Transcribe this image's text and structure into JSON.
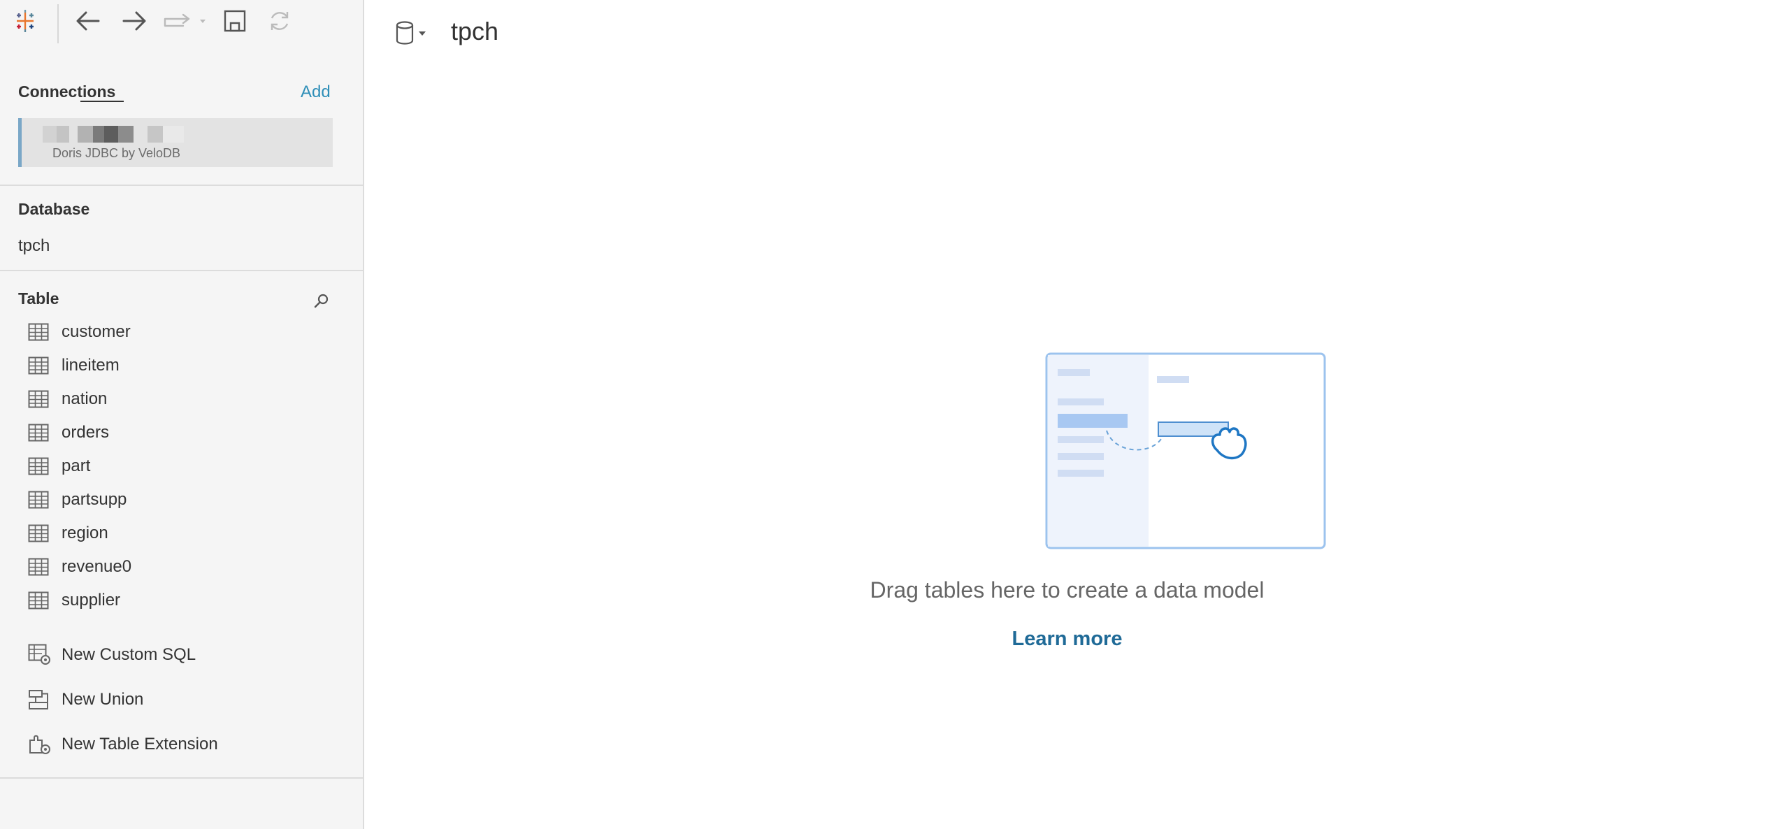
{
  "sidebar": {
    "connections_title": "Connections",
    "add_label": "Add",
    "connection": {
      "name": "Doris JDBC by VeloDB"
    },
    "database_title": "Database",
    "database_name": "tpch",
    "table_title": "Table",
    "tables": [
      {
        "label": "customer"
      },
      {
        "label": "lineitem"
      },
      {
        "label": "nation"
      },
      {
        "label": "orders"
      },
      {
        "label": "part"
      },
      {
        "label": "partsupp"
      },
      {
        "label": "region"
      },
      {
        "label": "revenue0"
      },
      {
        "label": "supplier"
      }
    ],
    "actions": [
      {
        "label": "New Custom SQL",
        "icon": "custom-sql-icon"
      },
      {
        "label": "New Union",
        "icon": "union-icon"
      },
      {
        "label": "New Table Extension",
        "icon": "table-extension-icon"
      }
    ]
  },
  "toolbar": {
    "icons": [
      "tableau-logo-icon",
      "back-arrow-icon",
      "forward-arrow-icon",
      "redo-dropdown-icon",
      "save-icon",
      "refresh-icon"
    ]
  },
  "main": {
    "datasource_title": "tpch",
    "empty_message": "Drag tables here to create a data model",
    "learn_more": "Learn more"
  },
  "colors": {
    "accent": "#2f8fb8",
    "link": "#1f6a97",
    "sidebar_bg": "#f5f5f5",
    "illustration_blue": "#1f77c4"
  }
}
